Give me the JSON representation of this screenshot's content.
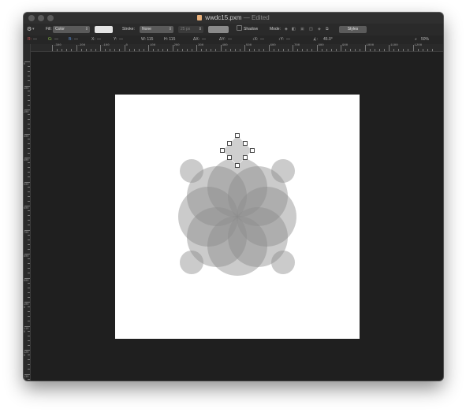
{
  "window": {
    "title": "wwdc15.pxm",
    "title_separator": "—",
    "status": "Edited"
  },
  "toolbar": {
    "settings_icon": "gear-icon",
    "fill_label": "Fill:",
    "fill_value": "Color",
    "fill_color": "#e4e4e4",
    "stroke_label": "Stroke:",
    "stroke_value": "None",
    "stroke_width": "25 px",
    "stroke_color": "#8a8a8a",
    "shadow_label": "Shadow",
    "mode_label": "Mode:",
    "styles_button": "Styles"
  },
  "coords": {
    "r_label": "R:",
    "g_label": "G:",
    "b_label": "B:",
    "x_label": "X:",
    "y_label": "Y:",
    "w_label": "W: 115",
    "h_label": "H: 115",
    "dx_label": "ΔX:",
    "dy_label": "ΔY:",
    "sx_label": "↕X:",
    "sy_label": "↕Y:",
    "angle_label": "∡:",
    "angle_value": "45.0°",
    "zoom_label": "50%",
    "empty": "—"
  },
  "ruler": {
    "h_labels": [
      "-300",
      "-200",
      "-100",
      "0",
      "100",
      "200",
      "300",
      "400",
      "500",
      "600",
      "700",
      "800",
      "900",
      "1000",
      "1100",
      "1200"
    ],
    "v_labels": [
      "0",
      "100",
      "200",
      "300",
      "400",
      "500",
      "600",
      "700",
      "800",
      "900",
      "1000",
      "1100",
      "1200",
      "1300",
      "1400"
    ]
  },
  "colors": {
    "window_bg": "#1f1f1f",
    "canvas_page": "#ffffff",
    "petal_fill": "#8c8c8c",
    "selection_handle": "#ffffff"
  }
}
